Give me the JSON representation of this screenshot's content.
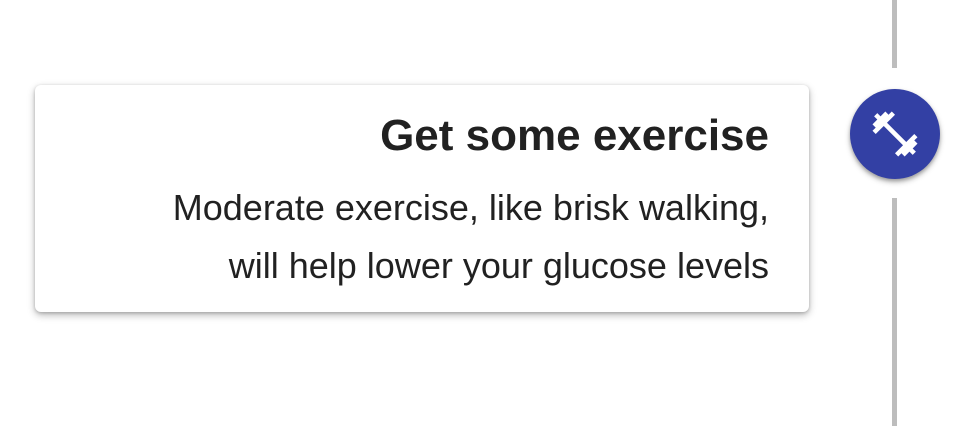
{
  "timeline": {
    "icon": "fitness-center-icon",
    "accent_color": "#3340a4",
    "line_color": "#bdbdbd"
  },
  "card": {
    "title": "Get some exercise",
    "body_lines": [
      "Moderate exercise, like brisk walking,",
      "will help lower your glucose levels"
    ]
  }
}
